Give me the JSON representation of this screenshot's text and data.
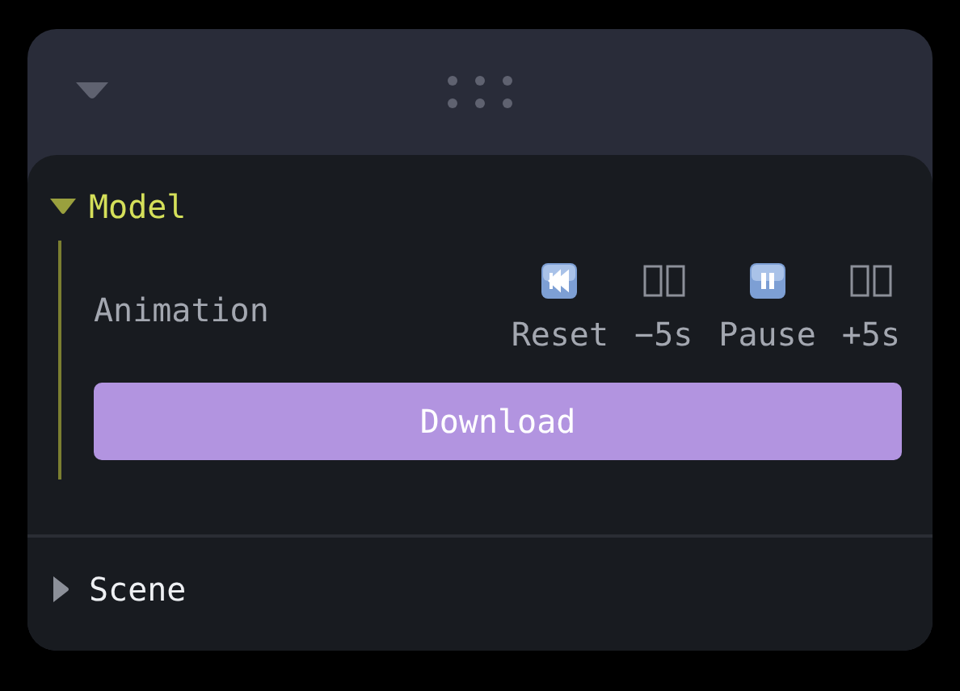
{
  "folders": [
    {
      "title": "Model",
      "expanded": true,
      "controls": [
        {
          "kind": "button-row",
          "label": "Animation",
          "buttons": [
            {
              "kind": "reset",
              "label": "Reset"
            },
            {
              "kind": "missing",
              "label": "−5s"
            },
            {
              "kind": "pause",
              "label": "Pause"
            },
            {
              "kind": "missing",
              "label": "+5s"
            }
          ]
        },
        {
          "kind": "button",
          "label": "Download"
        }
      ]
    },
    {
      "title": "Scene",
      "expanded": false
    }
  ]
}
